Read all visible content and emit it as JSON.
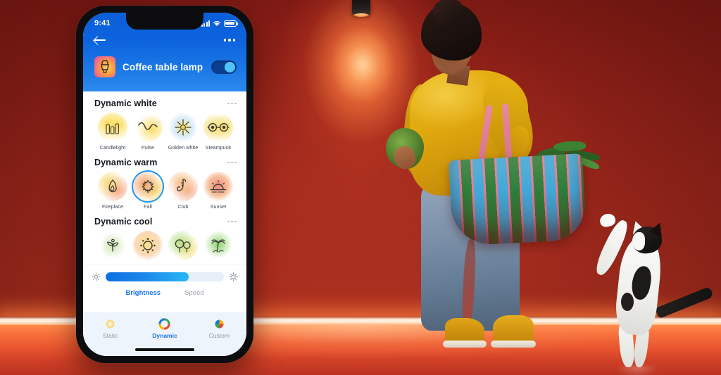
{
  "scene_photo": {
    "description": "Woman in yellow sweater carrying a striped shopping bag with vegetables, black-and-white cat standing on hind legs, dark red wall with ceiling spotlight and orange LED strip along the floor",
    "wall_color": "#8e2219",
    "led_strip_color": "#ff7a3c",
    "spotlight_glow_color": "#ffd6a0",
    "sweater_color": "#e0a80e",
    "floor_color": "#e8552f"
  },
  "phone": {
    "statusbar": {
      "time": "9:41",
      "signal_icon": "cellular-signal-icon",
      "wifi_icon": "wifi-icon",
      "battery_icon": "battery-icon"
    },
    "nav": {
      "back_icon": "back-arrow-icon",
      "overflow_icon": "overflow-menu-icon"
    },
    "device": {
      "thumbnail_icon": "lamp-thumbnail-icon",
      "name": "Coffee table lamp",
      "power_state": "on"
    },
    "sections": [
      {
        "title": "Dynamic white",
        "overflow_icon": "overflow-menu-icon",
        "scenes": [
          {
            "label": "Candlelight",
            "icon": "candles-icon",
            "glow": "#f7d94e",
            "selected": false
          },
          {
            "label": "Pulse",
            "icon": "wave-icon",
            "glow": "#f5d94a",
            "selected": false
          },
          {
            "label": "Golden white",
            "icon": "sunburst-icon",
            "glow": "#cfe4f5",
            "selected": false
          },
          {
            "label": "Steampunk",
            "icon": "goggles-icon",
            "glow": "#f3d560",
            "selected": false
          }
        ]
      },
      {
        "title": "Dynamic warm",
        "overflow_icon": "overflow-menu-icon",
        "scenes": [
          {
            "label": "Fireplace",
            "icon": "flame-icon",
            "glow": "#f5c98a",
            "selected": false
          },
          {
            "label": "Fall",
            "icon": "maple-leaf-icon",
            "glow": "#f3a268",
            "selected": true
          },
          {
            "label": "Club",
            "icon": "saxophone-icon",
            "glow": "#f6b07e",
            "selected": false
          },
          {
            "label": "Sunset",
            "icon": "sunset-icon",
            "glow": "#ef7f72",
            "selected": false
          }
        ]
      },
      {
        "title": "Dynamic cool",
        "overflow_icon": "overflow-menu-icon",
        "scenes": [
          {
            "label": "",
            "icon": "sprout-icon",
            "glow": "#d3e8b6",
            "selected": false
          },
          {
            "label": "",
            "icon": "sun-icon",
            "glow": "#f6d98a",
            "selected": false
          },
          {
            "label": "",
            "icon": "trees-icon",
            "glow": "#bfe08a",
            "selected": false
          },
          {
            "label": "",
            "icon": "palm-tree-icon",
            "glow": "#8fd06a",
            "selected": false
          }
        ]
      }
    ],
    "controls": {
      "low_brightness_icon": "brightness-low-icon",
      "high_brightness_icon": "brightness-high-icon",
      "slider_value_percent": 70,
      "tabs": [
        {
          "label": "Brightness",
          "active": true
        },
        {
          "label": "Speed",
          "active": false
        }
      ]
    },
    "bottom_nav": [
      {
        "label": "Static",
        "icon": "static-light-icon",
        "active": false
      },
      {
        "label": "Dynamic",
        "icon": "dynamic-color-wheel-icon",
        "active": true
      },
      {
        "label": "Custom",
        "icon": "custom-palette-icon",
        "active": false
      }
    ],
    "accent_color": "#1a73e8",
    "header_color": "#0d63de"
  }
}
